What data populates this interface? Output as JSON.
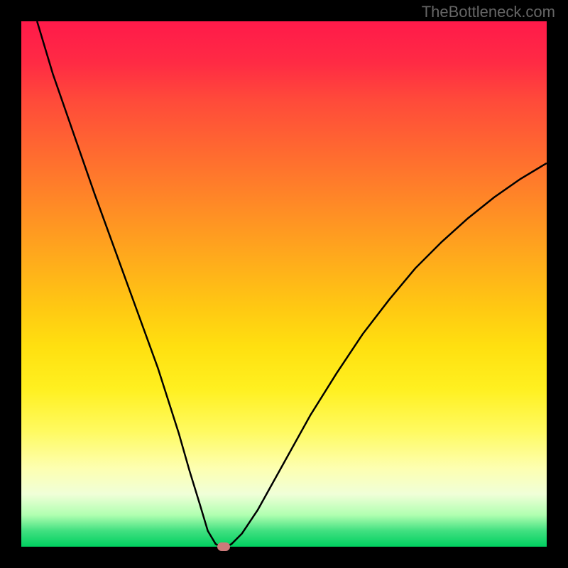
{
  "watermark": "TheBottleneck.com",
  "chart_data": {
    "type": "line",
    "title": "",
    "xlabel": "",
    "ylabel": "",
    "xlim": [
      0,
      100
    ],
    "ylim": [
      0,
      100
    ],
    "series": [
      {
        "name": "bottleneck-curve",
        "x": [
          3,
          6,
          10,
          14,
          18,
          22,
          26,
          30,
          32,
          34,
          35.5,
          37,
          38,
          39,
          40,
          42,
          45,
          50,
          55,
          60,
          65,
          70,
          75,
          80,
          85,
          90,
          95,
          100
        ],
        "values": [
          100,
          90,
          78.5,
          67,
          56,
          45,
          34,
          21.5,
          14.5,
          8,
          3,
          0.5,
          0,
          0,
          0.5,
          2.5,
          7,
          16,
          25,
          33,
          40.5,
          47,
          53,
          58,
          62.5,
          66.5,
          70,
          73
        ]
      }
    ],
    "marker": {
      "x": 38.5,
      "y": 0
    },
    "gradient_stops": [
      {
        "pct": 0,
        "color": "#ff1a4a"
      },
      {
        "pct": 50,
        "color": "#ffca12"
      },
      {
        "pct": 85,
        "color": "#fdffb0"
      },
      {
        "pct": 100,
        "color": "#00d060"
      }
    ]
  }
}
